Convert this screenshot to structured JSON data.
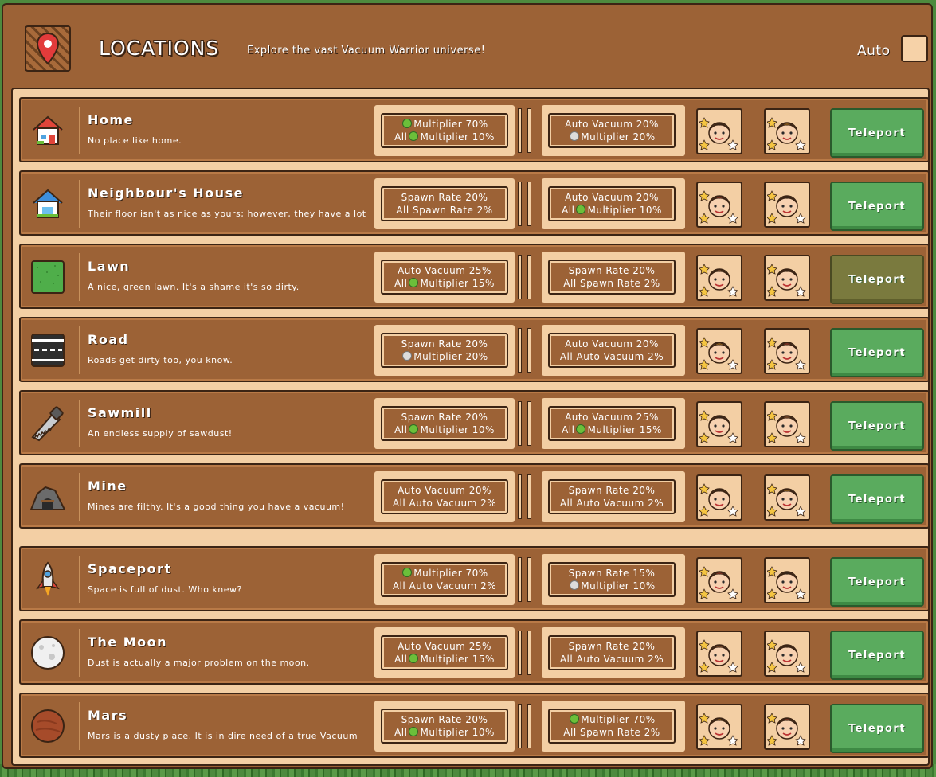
{
  "header": {
    "title": "LOCATIONS",
    "subtitle": "Explore the vast Vacuum Warrior universe!",
    "auto_label": "Auto",
    "auto_checked": false
  },
  "teleport_label": "Teleport",
  "locations": [
    {
      "icon": "house-red-icon",
      "name": "Home",
      "description": "No place like home.",
      "boost1": {
        "line1": "Multiplier 70%",
        "line1_icon": "green",
        "line2": "All  Multiplier 10%",
        "line2_icon": "green"
      },
      "boost2": {
        "line1": "Auto Vacuum 20%",
        "line2": "Multiplier 20%",
        "line2_icon": "silver"
      },
      "teleport_dim": false
    },
    {
      "icon": "house-blue-icon",
      "name": "Neighbour's House",
      "description": "Their floor isn't as nice as yours; however, they have a lot",
      "boost1": {
        "line1": "Spawn Rate 20%",
        "line2": "All Spawn Rate 2%"
      },
      "boost2": {
        "line1": "Auto Vacuum 20%",
        "line2": "All  Multiplier 10%",
        "line2_icon": "green"
      },
      "teleport_dim": false
    },
    {
      "icon": "lawn-icon",
      "name": "Lawn",
      "description": "A nice, green lawn. It's a shame it's so dirty.",
      "boost1": {
        "line1": "Auto Vacuum 25%",
        "line2": "All  Multiplier 15%",
        "line2_icon": "green"
      },
      "boost2": {
        "line1": "Spawn Rate 20%",
        "line2": "All Spawn Rate 2%"
      },
      "teleport_dim": true
    },
    {
      "icon": "road-icon",
      "name": "Road",
      "description": "Roads get dirty too, you know.",
      "boost1": {
        "line1": "Spawn Rate 20%",
        "line2": "Multiplier 20%",
        "line2_icon": "silver"
      },
      "boost2": {
        "line1": "Auto Vacuum 20%",
        "line2": "All Auto Vacuum 2%"
      },
      "teleport_dim": false
    },
    {
      "icon": "saw-icon",
      "name": "Sawmill",
      "description": "An endless supply of sawdust!",
      "boost1": {
        "line1": "Spawn Rate 20%",
        "line2": "All  Multiplier 10%",
        "line2_icon": "green"
      },
      "boost2": {
        "line1": "Auto Vacuum 25%",
        "line2": "All  Multiplier 15%",
        "line2_icon": "green"
      },
      "teleport_dim": false
    },
    {
      "icon": "mine-icon",
      "name": "Mine",
      "description": "Mines are filthy. It's a good thing you have a vacuum!",
      "boost1": {
        "line1": "Auto Vacuum 20%",
        "line2": "All Auto Vacuum 2%"
      },
      "boost2": {
        "line1": "Spawn Rate 20%",
        "line2": "All Auto Vacuum 2%"
      },
      "teleport_dim": false
    },
    {
      "icon": "rocket-icon",
      "name": "Spaceport",
      "description": "Space is full of dust. Who knew?",
      "boost1": {
        "line1": "Multiplier 70%",
        "line1_icon": "green",
        "line2": "All Auto Vacuum 2%"
      },
      "boost2": {
        "line1": "Spawn Rate 15%",
        "line2": "Multiplier 10%",
        "line2_icon": "silver"
      },
      "teleport_dim": false
    },
    {
      "icon": "moon-icon",
      "name": "The Moon",
      "description": "Dust is actually a major problem on the moon.",
      "boost1": {
        "line1": "Auto Vacuum 25%",
        "line2": "All  Multiplier 15%",
        "line2_icon": "green"
      },
      "boost2": {
        "line1": "Spawn Rate 20%",
        "line2": "All Auto Vacuum 2%"
      },
      "teleport_dim": false
    },
    {
      "icon": "mars-icon",
      "name": "Mars",
      "description": "Mars is a dusty place. It is in dire need of a true Vacuum",
      "boost1": {
        "line1": "Spawn Rate 20%",
        "line2": "All  Multiplier 10%",
        "line2_icon": "green"
      },
      "boost2": {
        "line1": "Multiplier 70%",
        "line1_icon": "green",
        "line2": "All Spawn Rate 2%"
      },
      "teleport_dim": false
    }
  ],
  "colors": {
    "panel": "#9c6236",
    "border": "#3b2414",
    "cream": "#f3cfa4",
    "teleport": "#5aab5e",
    "teleport_dim": "#7a7a3e"
  }
}
